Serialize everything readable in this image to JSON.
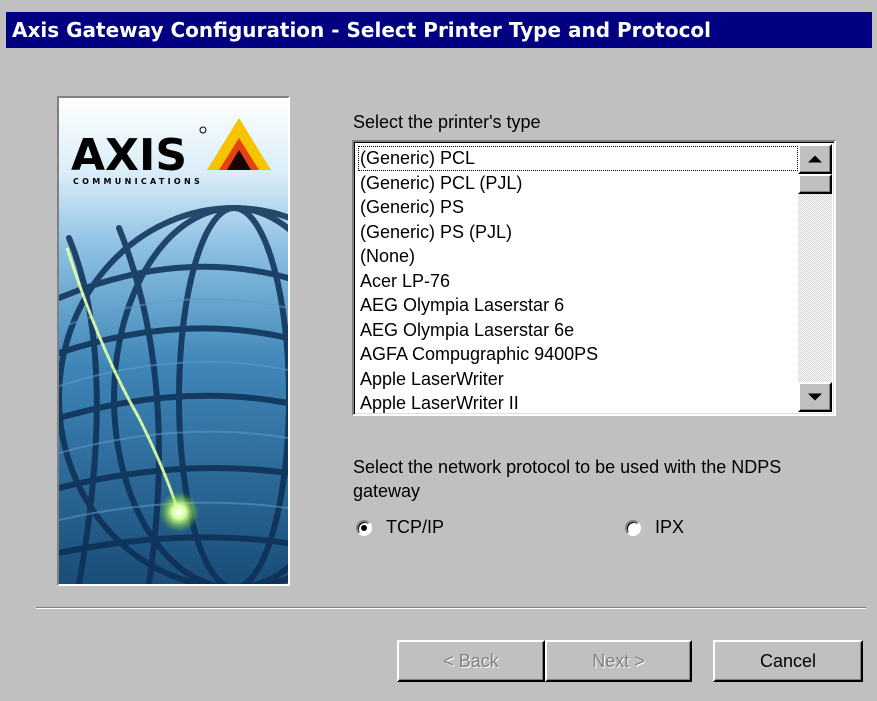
{
  "window": {
    "title": "Axis Gateway Configuration - Select Printer Type and Protocol"
  },
  "logo": {
    "brand": "AXIS",
    "tagline": "COMMUNICATIONS"
  },
  "printer_type": {
    "label": "Select the printer's type",
    "items": [
      "(Generic) PCL",
      "(Generic) PCL (PJL)",
      "(Generic) PS",
      "(Generic) PS (PJL)",
      "(None)",
      "Acer LP-76",
      "AEG Olympia Laserstar 6",
      "AEG Olympia Laserstar 6e",
      "AGFA Compugraphic 9400PS",
      "Apple LaserWriter",
      "Apple LaserWriter II"
    ],
    "selected": "(Generic) PCL"
  },
  "protocol": {
    "label": "Select the network protocol to be used with the NDPS gateway",
    "options": [
      {
        "label": "TCP/IP",
        "checked": true
      },
      {
        "label": "IPX",
        "checked": false
      }
    ]
  },
  "buttons": {
    "back": "< Back",
    "next": "Next >",
    "cancel": "Cancel"
  },
  "colors": {
    "title_bar": "#000080",
    "dialog_face": "#c0c0c0",
    "logo_yellow": "#f5c400",
    "comet": "#b8f070"
  }
}
